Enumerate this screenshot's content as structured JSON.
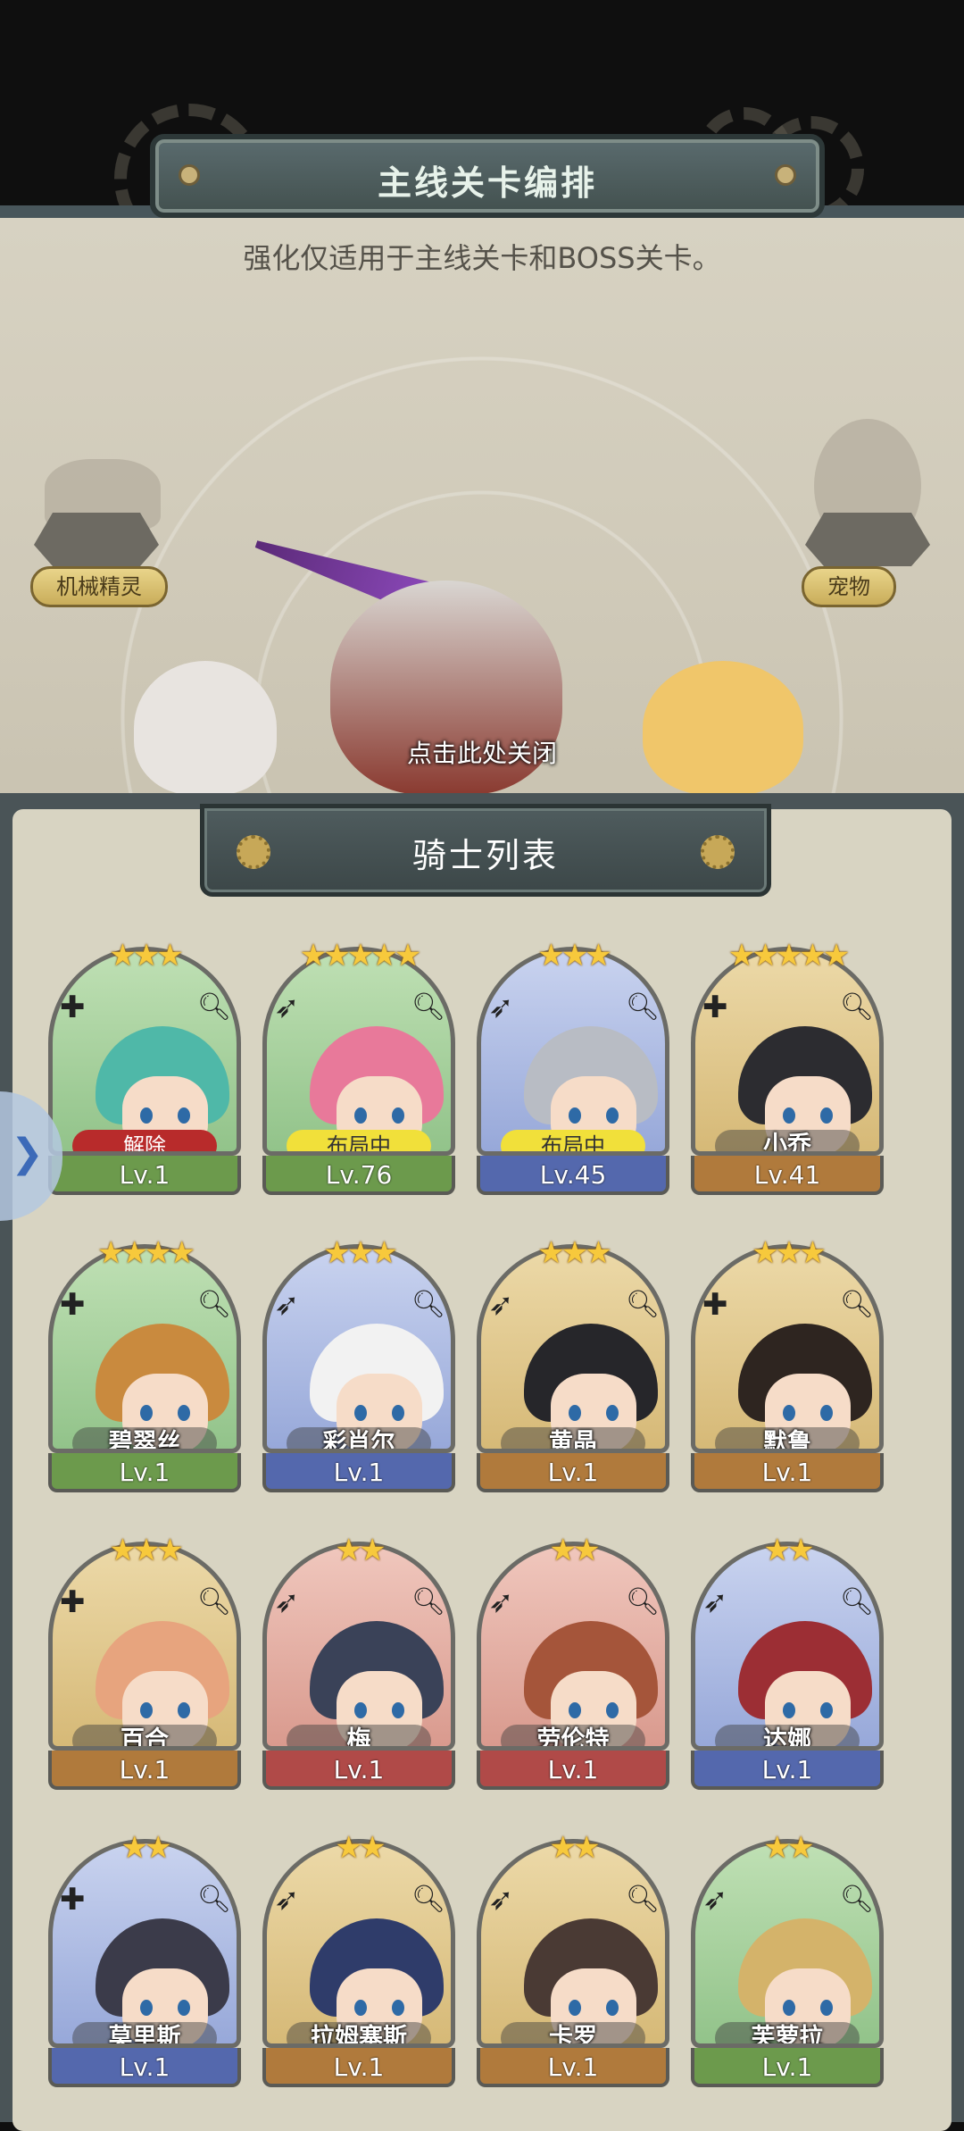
{
  "header": {
    "title": "主线关卡编排",
    "notice": "强化仅适用于主线关卡和BOSS关卡。"
  },
  "formation": {
    "left_slot_label": "机械精灵",
    "right_slot_label": "宠物",
    "close_hint": "点击此处关闭"
  },
  "list": {
    "title": "骑士列表"
  },
  "side_tab_icon": "chevron-right-icon",
  "colors": {
    "green": "#6c9a4c",
    "blue": "#5468ad",
    "gold": "#b07a3c",
    "red": "#b04a48",
    "status_red": "#b82b2b",
    "status_yellow": "#f1e03a"
  },
  "cards": [
    {
      "stars": "★★★",
      "label": "解除",
      "label_style": "red",
      "level": "Lv.1",
      "theme": "green",
      "top_icon": "add-icon",
      "hair": "#4fb8a8"
    },
    {
      "stars": "★★★★★",
      "label": "布局中",
      "label_style": "yellow",
      "level": "Lv.76",
      "theme": "green",
      "top_icon": "bow-icon",
      "hair": "#e8799a"
    },
    {
      "stars": "★★★",
      "label": "布局中",
      "label_style": "yellow",
      "level": "Lv.45",
      "theme": "blue",
      "top_icon": "bow-icon",
      "hair": "#b8bcc4"
    },
    {
      "stars": "★★★★★",
      "label": "小乔",
      "label_style": "name",
      "level": "Lv.41",
      "theme": "gold",
      "top_icon": "add-icon",
      "hair": "#2c2c30"
    },
    {
      "stars": "★★★★",
      "label": "碧翠丝",
      "label_style": "name",
      "level": "Lv.1",
      "theme": "green",
      "top_icon": "add-icon",
      "hair": "#c98a3e"
    },
    {
      "stars": "★★★",
      "label": "彩肖尔",
      "label_style": "name",
      "level": "Lv.1",
      "theme": "blue",
      "top_icon": "bow-icon",
      "hair": "#f2f2f2"
    },
    {
      "stars": "★★★",
      "label": "黄晶",
      "label_style": "name",
      "level": "Lv.1",
      "theme": "gold",
      "top_icon": "bow-icon",
      "hair": "#26262a"
    },
    {
      "stars": "★★★",
      "label": "默鲁",
      "label_style": "name",
      "level": "Lv.1",
      "theme": "gold",
      "top_icon": "add-icon",
      "hair": "#2e2520"
    },
    {
      "stars": "★★★",
      "label": "百合",
      "label_style": "name",
      "level": "Lv.1",
      "theme": "gold",
      "top_icon": "add-icon",
      "hair": "#e7a47e"
    },
    {
      "stars": "★★",
      "label": "梅",
      "label_style": "name",
      "level": "Lv.1",
      "theme": "red",
      "top_icon": "bow-icon",
      "hair": "#3a4258"
    },
    {
      "stars": "★★",
      "label": "劳伦特",
      "label_style": "name",
      "level": "Lv.1",
      "theme": "red",
      "top_icon": "bow-icon",
      "hair": "#a5553a"
    },
    {
      "stars": "★★",
      "label": "达娜",
      "label_style": "name",
      "level": "Lv.1",
      "theme": "blue",
      "top_icon": "bow-icon",
      "hair": "#9c2e34"
    },
    {
      "stars": "★★",
      "label": "莫里斯",
      "label_style": "name",
      "level": "Lv.1",
      "theme": "blue",
      "top_icon": "add-icon",
      "hair": "#3b3b4a"
    },
    {
      "stars": "★★",
      "label": "拉姆塞斯",
      "label_style": "name",
      "level": "Lv.1",
      "theme": "gold",
      "top_icon": "bow-icon",
      "hair": "#2f3c6a"
    },
    {
      "stars": "★★",
      "label": "卡罗",
      "label_style": "name",
      "level": "Lv.1",
      "theme": "gold",
      "top_icon": "bow-icon",
      "hair": "#4a3a34"
    },
    {
      "stars": "★★",
      "label": "芙萝拉",
      "label_style": "name",
      "level": "Lv.1",
      "theme": "green",
      "top_icon": "bow-icon",
      "hair": "#d4b36a"
    }
  ]
}
